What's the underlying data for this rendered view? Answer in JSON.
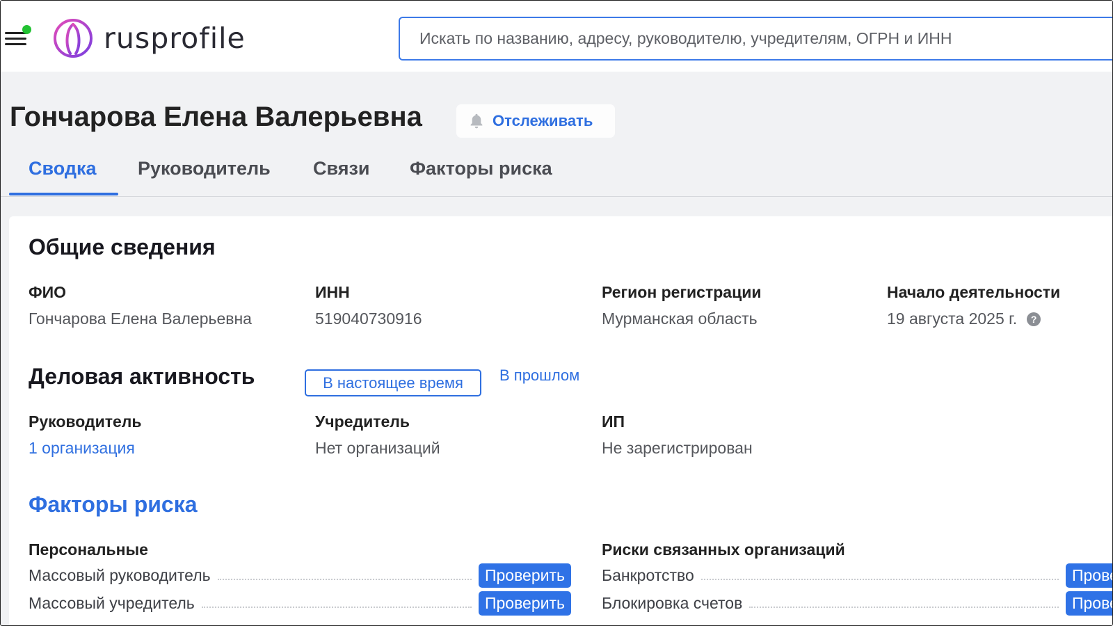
{
  "header": {
    "logo_text": "rusprofile",
    "search_placeholder": "Искать по названию, адресу, руководителю, учредителям, ОГРН и ИНН"
  },
  "person": {
    "name": "Гончарова Елена Валерьевна",
    "follow_label": "Отслеживать"
  },
  "tabs": [
    {
      "label": "Сводка",
      "active": true
    },
    {
      "label": "Руководитель",
      "active": false
    },
    {
      "label": "Связи",
      "active": false
    },
    {
      "label": "Факторы риска",
      "active": false
    }
  ],
  "general": {
    "title": "Общие сведения",
    "fields": [
      {
        "label": "ФИО",
        "value": "Гончарова Елена Валерьевна"
      },
      {
        "label": "ИНН",
        "value": "519040730916"
      },
      {
        "label": "Регион регистрации",
        "value": "Мурманская область"
      },
      {
        "label": "Начало деятельности",
        "value": "19 августа 2025 г."
      }
    ]
  },
  "activity": {
    "title": "Деловая активность",
    "filter_current": "В настоящее время",
    "filter_past": "В прошлом",
    "fields": [
      {
        "label": "Руководитель",
        "value": "1 организация"
      },
      {
        "label": "Учредитель",
        "value": "Нет организаций"
      },
      {
        "label": "ИП",
        "value": "Не зарегистрирован"
      }
    ]
  },
  "risks": {
    "title": "Факторы риска",
    "personal_title": "Персональные",
    "related_title": "Риски связанных организаций",
    "check_label": "Проверить",
    "personal": [
      "Массовый руководитель",
      "Массовый учредитель"
    ],
    "related": [
      "Банкротство",
      "Блокировка счетов"
    ]
  },
  "colors": {
    "accent": "#2f6fe0",
    "status_online": "#22c232",
    "button_bg": "#2f72e6"
  }
}
